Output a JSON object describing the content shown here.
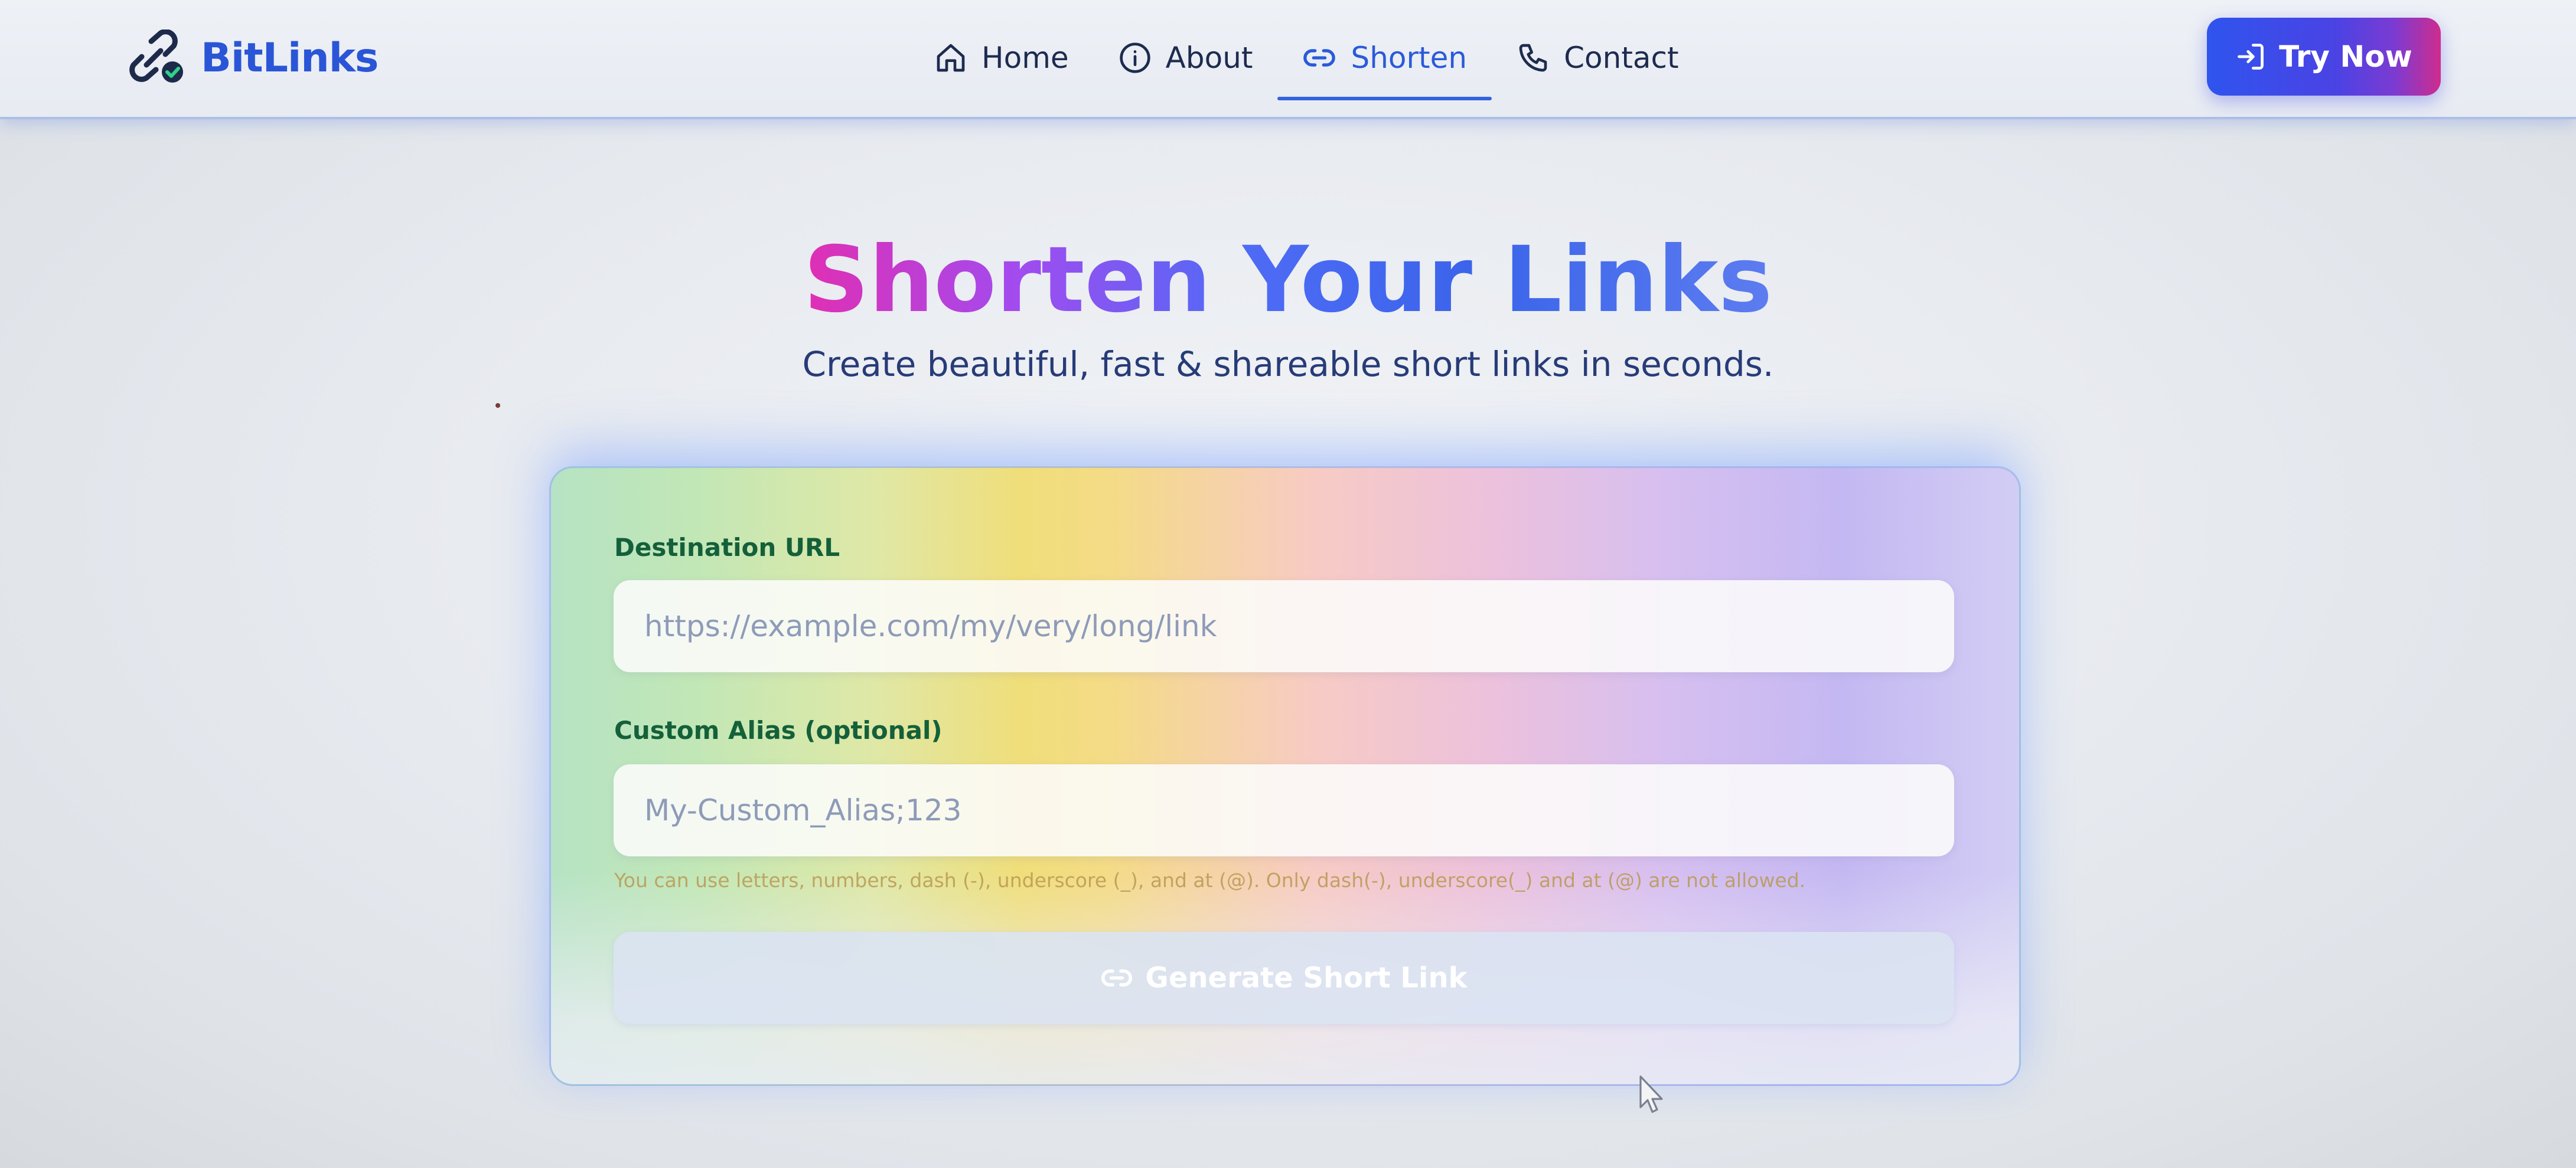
{
  "brand": {
    "name": "BitLinks",
    "icon": "link-check-icon"
  },
  "nav": {
    "items": [
      {
        "label": "Home",
        "icon": "home-icon"
      },
      {
        "label": "About",
        "icon": "info-icon"
      },
      {
        "label": "Shorten",
        "icon": "link-icon",
        "active": true
      },
      {
        "label": "Contact",
        "icon": "phone-icon"
      }
    ],
    "cta": {
      "label": "Try Now",
      "icon": "login-icon"
    }
  },
  "hero": {
    "title": "Shorten Your Links",
    "subtitle": "Create beautiful, fast & shareable short links in seconds."
  },
  "form": {
    "destination": {
      "label": "Destination URL",
      "placeholder": "https://example.com/my/very/long/link"
    },
    "alias": {
      "label": "Custom Alias (optional)",
      "placeholder": "My-Custom_Alias;123"
    },
    "hint": "You can use letters, numbers, dash (-), underscore (_), and at (@). Only dash(-), underscore(_) and at (@) are not allowed.",
    "submit": {
      "label": "Generate Short Link",
      "icon": "link-icon"
    }
  },
  "colors": {
    "brand": "#2a55d6",
    "active_nav": "#2a5ad9",
    "cta_gradient": [
      "#2f54ee",
      "#cf2c8e"
    ],
    "title_gradient": [
      "#e02fb3",
      "#4f6bf6"
    ],
    "label_green": "#14603a"
  }
}
